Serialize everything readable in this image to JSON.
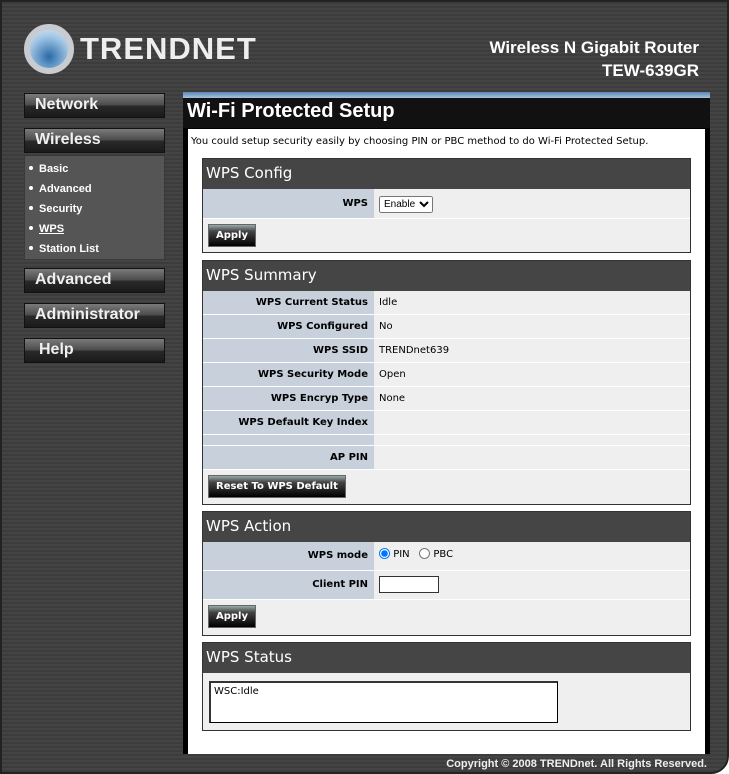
{
  "header": {
    "brand": "TRENDNET",
    "product": "Wireless N Gigabit Router",
    "model": "TEW-639GR"
  },
  "nav": {
    "network": "Network",
    "wireless": "Wireless",
    "advanced": "Advanced",
    "administrator": "Administrator",
    "help": "Help",
    "wireless_items": [
      "Basic",
      "Advanced",
      "Security",
      "WPS",
      "Station List"
    ],
    "active": "WPS"
  },
  "page": {
    "title": "Wi-Fi Protected Setup",
    "intro": "You could setup security easily by choosing PIN or PBC method to do Wi-Fi Protected Setup."
  },
  "config": {
    "title": "WPS Config",
    "wps_label": "WPS",
    "wps_value": "Enable",
    "apply": "Apply"
  },
  "summary": {
    "title": "WPS Summary",
    "rows": [
      {
        "label": "WPS Current Status",
        "value": "Idle"
      },
      {
        "label": "WPS Configured",
        "value": "No"
      },
      {
        "label": "WPS SSID",
        "value": "TRENDnet639"
      },
      {
        "label": "WPS Security Mode",
        "value": "Open"
      },
      {
        "label": "WPS Encryp Type",
        "value": "None"
      },
      {
        "label": "WPS Default Key Index",
        "value": ""
      }
    ],
    "ap_pin_label": "AP PIN",
    "ap_pin_value": "",
    "reset": "Reset To WPS Default"
  },
  "action": {
    "title": "WPS Action",
    "mode_label": "WPS mode",
    "mode_pin": "PIN",
    "mode_pbc": "PBC",
    "selected_mode": "PIN",
    "client_pin_label": "Client PIN",
    "client_pin_value": "",
    "apply": "Apply"
  },
  "status": {
    "title": "WPS Status",
    "text": "WSC:Idle"
  },
  "footer": {
    "copyright": "Copyright © 2008 TRENDnet. All Rights Reserved."
  }
}
